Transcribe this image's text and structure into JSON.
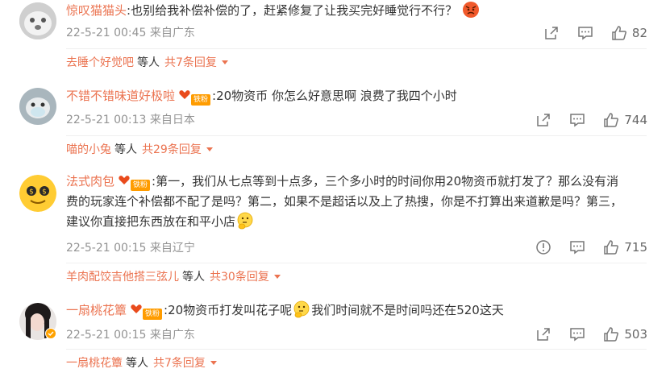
{
  "comments": [
    {
      "username": "惊叹猫猫头",
      "text": ":也别给我补偿补偿的了，赶紧修复了让我买完好睡觉行不行？",
      "timestamp": "22-5-21 00:45",
      "location": "来自广东",
      "likes": "82",
      "reply_user": "去睡个好觉吧",
      "reply_others": "等人",
      "reply_total": "共7条回复",
      "emoji": "angry-face"
    },
    {
      "username": "不错不错味道好极啦",
      "badge": "铁粉",
      "text": ":20物资币 你怎么好意思啊 浪费了我四个小时",
      "timestamp": "22-5-21 00:13",
      "location": "来自日本",
      "likes": "744",
      "reply_user": "喵的小兔",
      "reply_others": "等人",
      "reply_total": "共29条回复"
    },
    {
      "username": "法式肉包",
      "badge": "铁粉",
      "text_line1": ":第一，我们从七点等到十点多，三个多小时的时间你用20物资币就打发了？那么没有消",
      "text_line2": "费的玩家连个补偿都不配了是吗？第二，如果不是超话以及上了热搜，你是不打算出来道歉是吗？第三，",
      "text_line3": "建议你直接把东西放在和平小店",
      "timestamp": "22-5-21 00:15",
      "location": "来自辽宁",
      "likes": "715",
      "reply_user": "羊肉配饺吉他搭三弦儿",
      "reply_others": "等人",
      "reply_total": "共30条回复",
      "emoji": "thinking-face"
    },
    {
      "username": "一扇桃花簟",
      "badge": "铁粉",
      "text_a": ":20物资币打发叫花子呢",
      "text_b": "我们时间就不是时间吗还在520这天",
      "timestamp": "22-5-21 00:15",
      "location": "来自广东",
      "likes": "503",
      "reply_user": "一扇桃花簟",
      "reply_others": "等人",
      "reply_total": "共7条回复",
      "emoji": "thinking-face"
    }
  ],
  "colors": {
    "username": "#eb7350",
    "meta": "#939393",
    "badge": "#ff9c00"
  },
  "icons": [
    "share-icon",
    "comment-icon",
    "like-icon",
    "report-icon",
    "angry-emoji-icon",
    "thinking-emoji-icon",
    "fan-heart-icon"
  ]
}
